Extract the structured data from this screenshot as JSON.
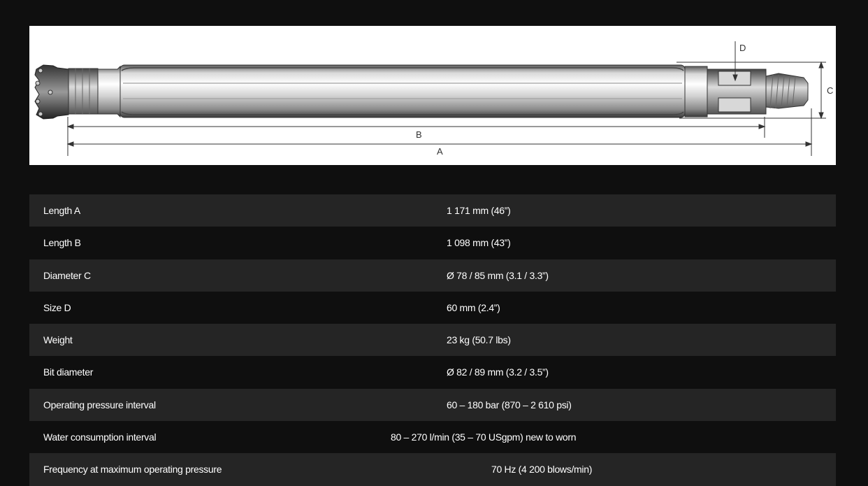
{
  "diagram": {
    "labels": {
      "a": "A",
      "b": "B",
      "c": "C",
      "d": "D"
    }
  },
  "specs": {
    "rows": [
      {
        "label": "Length A",
        "value": "1 171 mm (46”)"
      },
      {
        "label": "Length B",
        "value": "1 098 mm (43”)"
      },
      {
        "label": "Diameter C",
        "value": "Ø 78 / 85 mm (3.1 / 3.3”)"
      },
      {
        "label": "Size D",
        "value": "60 mm (2.4”)"
      },
      {
        "label": "Weight",
        "value": "23 kg (50.7 lbs)"
      },
      {
        "label": "Bit diameter",
        "value": "Ø 82 / 89 mm (3.2 / 3.5”)"
      },
      {
        "label": "Operating pressure interval",
        "value": "60 – 180 bar (870 – 2 610 psi)"
      },
      {
        "label": "Water consumption interval",
        "value": "80 – 270 l/min (35 – 70 USgpm) new to worn"
      },
      {
        "label": "Frequency at maximum operating pressure",
        "value": "70 Hz (4 200 blows/min)"
      }
    ]
  }
}
